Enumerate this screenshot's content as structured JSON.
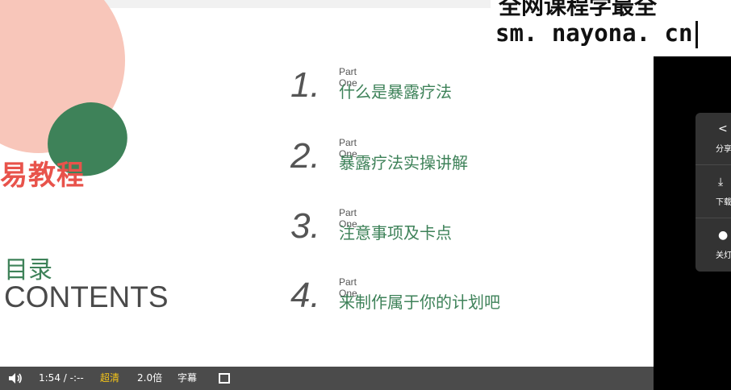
{
  "slide": {
    "banner_text": "易教程",
    "toc_cn": "目录",
    "toc_en": "CONTENTS",
    "items": [
      {
        "num": "1.",
        "part": "Part One",
        "title": "什么是暴露疗法"
      },
      {
        "num": "2.",
        "part": "Part One",
        "title": "暴露疗法实操讲解"
      },
      {
        "num": "3.",
        "part": "Part One",
        "title": "注意事项及卡点"
      },
      {
        "num": "4.",
        "part": "Part One",
        "title": "来制作属于你的计划吧"
      }
    ]
  },
  "watermark": {
    "top_text": "全网课程学最全",
    "url": "sm. nayona. cn"
  },
  "side_panel": {
    "share_label": "分享",
    "download_label": "下载",
    "light_label": "关灯"
  },
  "controls": {
    "time": "1:54 / -:--",
    "quality": "超清",
    "speed": "2.0倍",
    "subtitle": "字幕"
  },
  "colors": {
    "accent_green": "#3e8259",
    "banner_red": "#e8534b",
    "quality_yellow": "#f5c518",
    "control_bar": "#4b4b4b"
  }
}
